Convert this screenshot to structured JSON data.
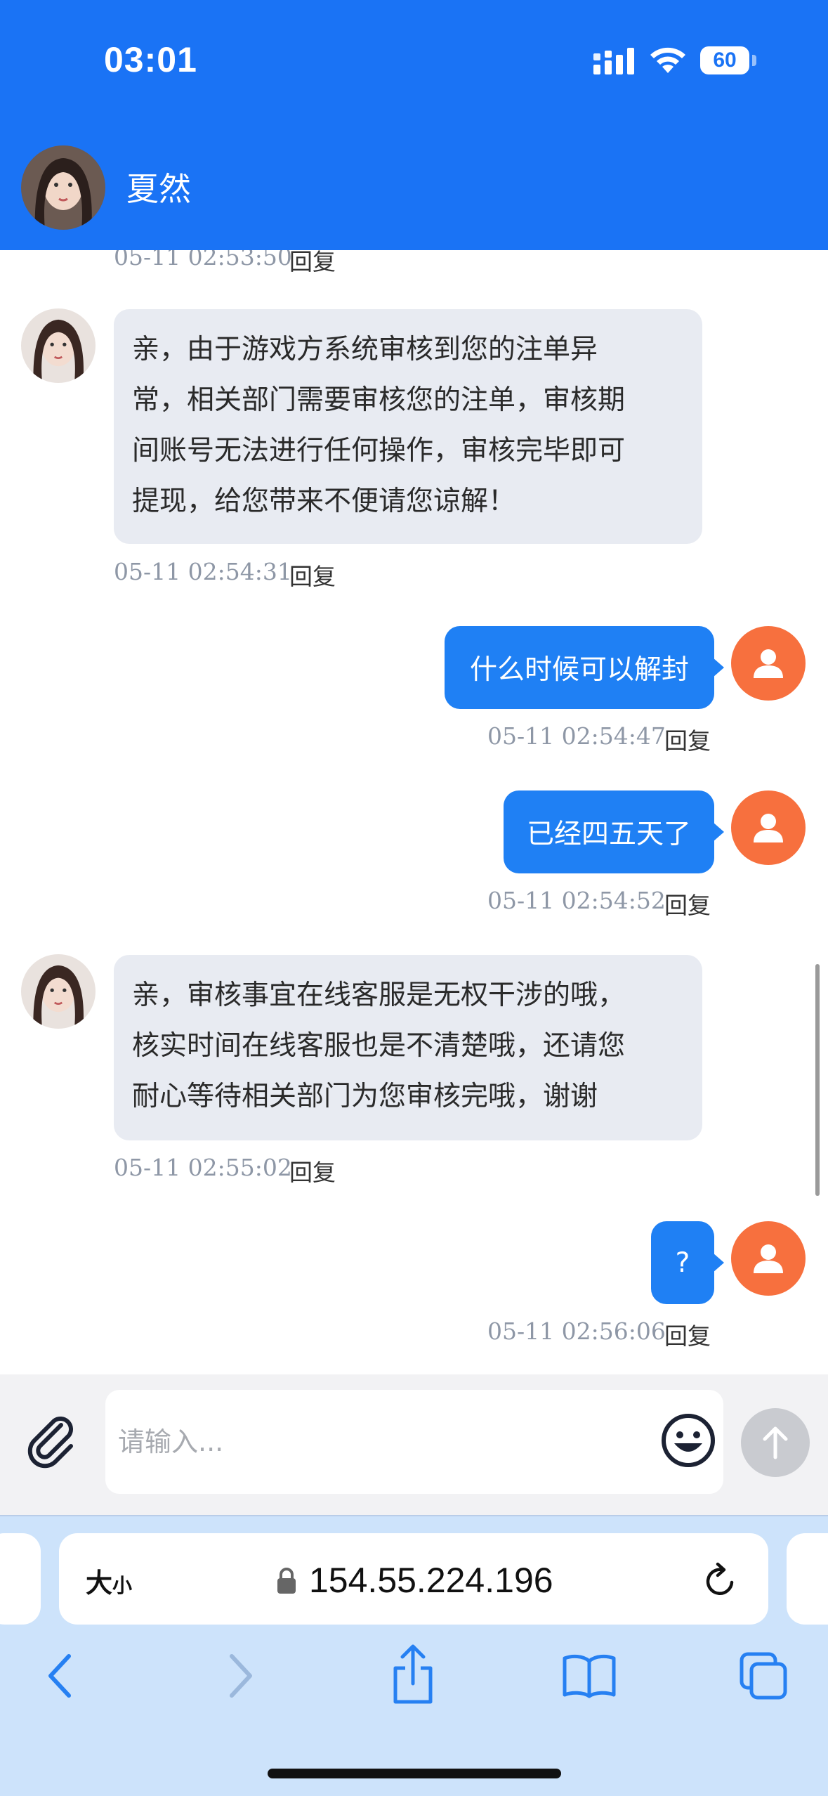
{
  "status_bar": {
    "time": "03:01",
    "battery": "60"
  },
  "header": {
    "contact_name": "夏然"
  },
  "messages": [
    {
      "timestamp": "05-11 02:53:50",
      "reply": "回复"
    },
    {
      "side": "in",
      "text_lines": [
        "亲，由于游戏方系统审核到您的注单异",
        "常，相关部门需要审核您的注单，审核期",
        "间账号无法进行任何操作，审核完毕即可",
        "提现，给您带来不便请您谅解！"
      ],
      "timestamp": "05-11 02:54:31",
      "reply": "回复"
    },
    {
      "side": "out",
      "text": "什么时候可以解封",
      "timestamp": "05-11 02:54:47",
      "reply": "回复"
    },
    {
      "side": "out",
      "text": "已经四五天了",
      "timestamp": "05-11 02:54:52",
      "reply": "回复"
    },
    {
      "side": "in",
      "text_lines": [
        "亲，审核事宜在线客服是无权干涉的哦，",
        "核实时间在线客服也是不清楚哦，还请您",
        "耐心等待相关部门为您审核完哦，谢谢"
      ],
      "timestamp": "05-11 02:55:02",
      "reply": "回复"
    },
    {
      "side": "out",
      "text": "?",
      "timestamp": "05-11 02:56:06",
      "reply": "回复"
    }
  ],
  "composer": {
    "placeholder": "请输入..."
  },
  "browser": {
    "text_size_big": "大",
    "text_size_small": "小",
    "url": "154.55.224.196"
  },
  "colors": {
    "header": "#1a73f5",
    "outgoing_bubble": "#1f80f4",
    "incoming_bubble": "#e8ebf2",
    "user_avatar": "#f7703e",
    "browser_bar": "#cde3fb"
  },
  "icons": {
    "status": [
      "signal-icon",
      "wifi-icon",
      "battery-icon"
    ],
    "composer": [
      "paperclip-icon",
      "emoji-icon",
      "arrow-up-icon"
    ],
    "browser": [
      "lock-icon",
      "reload-icon",
      "back-icon",
      "forward-icon",
      "share-icon",
      "bookmarks-icon",
      "tabs-icon"
    ]
  }
}
